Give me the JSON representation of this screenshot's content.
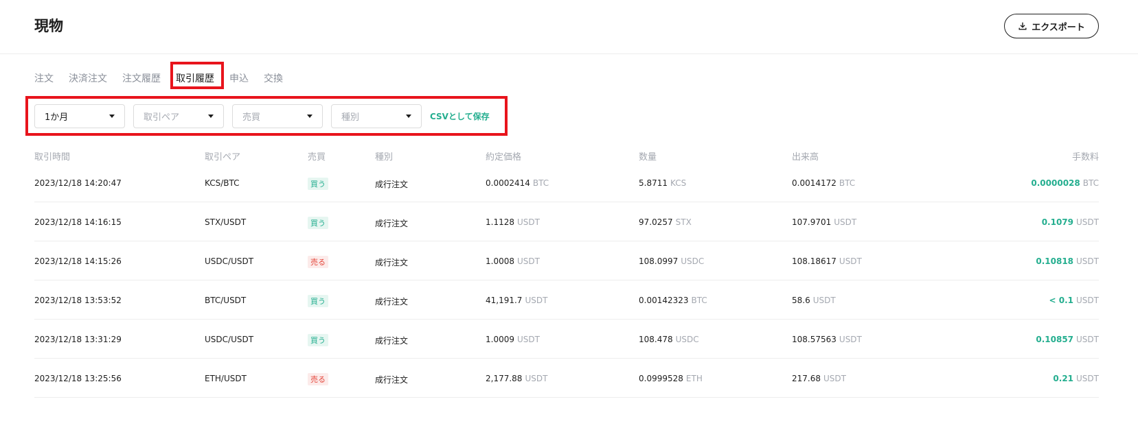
{
  "header": {
    "title": "現物",
    "export_label": "エクスポート"
  },
  "tabs": [
    {
      "label": "注文",
      "active": false
    },
    {
      "label": "決済注文",
      "active": false
    },
    {
      "label": "注文履歴",
      "active": false
    },
    {
      "label": "取引履歴",
      "active": true
    },
    {
      "label": "申込",
      "active": false
    },
    {
      "label": "交換",
      "active": false
    }
  ],
  "filters": {
    "period": "1か月",
    "pair_placeholder": "取引ペア",
    "side_placeholder": "売買",
    "type_placeholder": "種別",
    "csv_label": "CSVとして保存"
  },
  "columns": {
    "time": "取引時間",
    "pair": "取引ペア",
    "side": "売買",
    "type": "種別",
    "price": "約定価格",
    "qty": "数量",
    "volume": "出来高",
    "fee": "手数料"
  },
  "rows": [
    {
      "time": "2023/12/18 14:20:47",
      "pair": "KCS/BTC",
      "side": "買う",
      "side_kind": "buy",
      "type": "成行注文",
      "price": "0.0002414",
      "price_unit": "BTC",
      "qty": "5.8711",
      "qty_unit": "KCS",
      "volume": "0.0014172",
      "volume_unit": "BTC",
      "fee": "0.0000028",
      "fee_unit": "BTC"
    },
    {
      "time": "2023/12/18 14:16:15",
      "pair": "STX/USDT",
      "side": "買う",
      "side_kind": "buy",
      "type": "成行注文",
      "price": "1.1128",
      "price_unit": "USDT",
      "qty": "97.0257",
      "qty_unit": "STX",
      "volume": "107.9701",
      "volume_unit": "USDT",
      "fee": "0.1079",
      "fee_unit": "USDT"
    },
    {
      "time": "2023/12/18 14:15:26",
      "pair": "USDC/USDT",
      "side": "売る",
      "side_kind": "sell",
      "type": "成行注文",
      "price": "1.0008",
      "price_unit": "USDT",
      "qty": "108.0997",
      "qty_unit": "USDC",
      "volume": "108.18617",
      "volume_unit": "USDT",
      "fee": "0.10818",
      "fee_unit": "USDT"
    },
    {
      "time": "2023/12/18 13:53:52",
      "pair": "BTC/USDT",
      "side": "買う",
      "side_kind": "buy",
      "type": "成行注文",
      "price": "41,191.7",
      "price_unit": "USDT",
      "qty": "0.00142323",
      "qty_unit": "BTC",
      "volume": "58.6",
      "volume_unit": "USDT",
      "fee": "< 0.1",
      "fee_unit": "USDT"
    },
    {
      "time": "2023/12/18 13:31:29",
      "pair": "USDC/USDT",
      "side": "買う",
      "side_kind": "buy",
      "type": "成行注文",
      "price": "1.0009",
      "price_unit": "USDT",
      "qty": "108.478",
      "qty_unit": "USDC",
      "volume": "108.57563",
      "volume_unit": "USDT",
      "fee": "0.10857",
      "fee_unit": "USDT"
    },
    {
      "time": "2023/12/18 13:25:56",
      "pair": "ETH/USDT",
      "side": "売る",
      "side_kind": "sell",
      "type": "成行注文",
      "price": "2,177.88",
      "price_unit": "USDT",
      "qty": "0.0999528",
      "qty_unit": "ETH",
      "volume": "217.68",
      "volume_unit": "USDT",
      "fee": "0.21",
      "fee_unit": "USDT"
    }
  ],
  "colors": {
    "accent": "#24ae8f",
    "sell": "#e4473c",
    "highlight": "#e8141c",
    "muted": "#a4a8b0"
  }
}
